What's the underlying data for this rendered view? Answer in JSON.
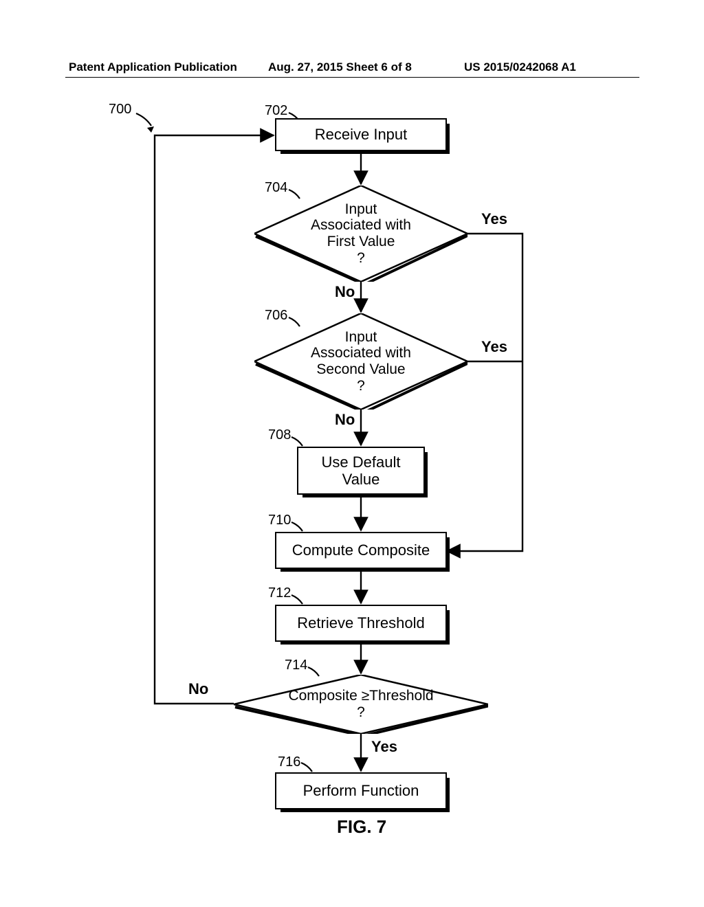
{
  "header": {
    "left": "Patent Application Publication",
    "center": "Aug. 27, 2015  Sheet 6 of 8",
    "right": "US 2015/0242068 A1"
  },
  "refs": {
    "r700": "700",
    "r702": "702",
    "r704": "704",
    "r706": "706",
    "r708": "708",
    "r710": "710",
    "r712": "712",
    "r714": "714",
    "r716": "716"
  },
  "nodes": {
    "n702": "Receive Input",
    "n704": "Input\nAssociated with\nFirst Value\n?",
    "n706": "Input\nAssociated with\nSecond Value\n?",
    "n708": "Use Default\nValue",
    "n710": "Compute Composite",
    "n712": "Retrieve Threshold",
    "n714": "Composite ≥Threshold\n?",
    "n716": "Perform Function"
  },
  "edges": {
    "yes": "Yes",
    "no": "No"
  },
  "figure": "FIG. 7"
}
